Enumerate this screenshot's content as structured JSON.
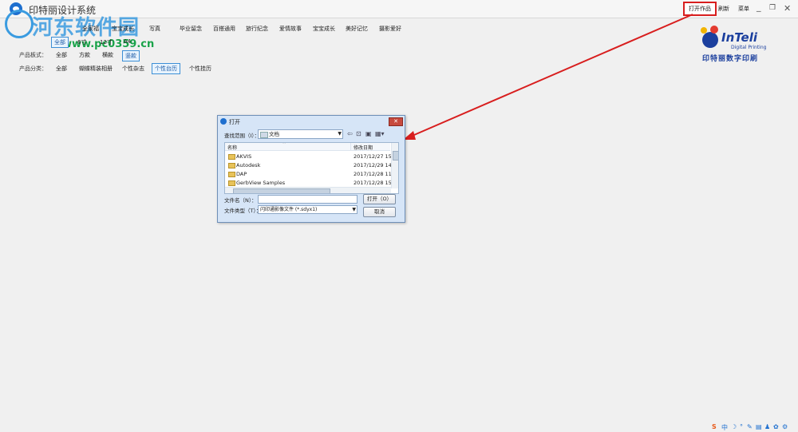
{
  "app": {
    "title": "印特丽设计系统",
    "open_works": "打开作品",
    "refresh": "刷新",
    "menu": "菜单",
    "minimize": "_",
    "restore": "❐",
    "close": "✕"
  },
  "watermark": {
    "text": "河东软件园",
    "url": "www.pc0359.cn"
  },
  "filters": {
    "themes": [
      "全部",
      "6寸",
      "12寸",
      "A4"
    ],
    "categories_top": [
      "全家福",
      "宝宝成长",
      "写真",
      "毕业留念",
      "百搭通用",
      "旅行纪念",
      "爱情故事",
      "宝宝成长",
      "美好记忆",
      "摄影爱好"
    ],
    "style_label": "产品板式：",
    "styles": [
      "全部",
      "方款",
      "横款",
      "竖款"
    ],
    "type_label": "产品分类：",
    "types": [
      "全部",
      "蝴蝶精装相册",
      "个性杂志",
      "个性台历",
      "个性挂历"
    ]
  },
  "brand": {
    "name": "InTeli",
    "sub": "Digital Printing",
    "cn": "印特丽数字印刷"
  },
  "dialog": {
    "title": "打开",
    "close": "✕",
    "look_in_label": "查找范围（I）：",
    "look_in_value": "文档",
    "columns": {
      "name": "名称",
      "date": "修改日期"
    },
    "files": [
      {
        "name": "AKVIS",
        "date": "2017/12/27 15:1"
      },
      {
        "name": "Autodesk",
        "date": "2017/12/29 14:5"
      },
      {
        "name": "DAP",
        "date": "2017/12/28 11:0"
      },
      {
        "name": "GerbView Samples",
        "date": "2017/12/28 15:2"
      }
    ],
    "filename_label": "文件名（N）：",
    "filetype_label": "文件类型（T）：",
    "filetype_value": "闪印通影像文件 (*.sdyx1)",
    "open_button": "打开（O）",
    "cancel_button": "取消"
  },
  "tray": [
    "S",
    "中",
    "☽",
    "°",
    "✎",
    "▤",
    "♟",
    "✿",
    "⚙"
  ],
  "colors": {
    "accent": "#3d8fd6",
    "highlight": "#d81e1e",
    "brand": "#1b3f9e"
  }
}
